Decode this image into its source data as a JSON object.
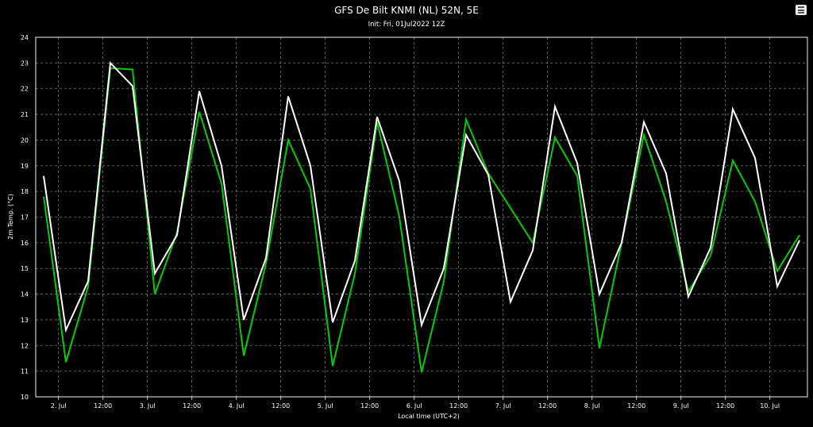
{
  "chart_data": {
    "type": "line",
    "title": "GFS De Bilt KNMI (NL) 52N, 5E",
    "subtitle": "Init: Fri, 01Jul2022 12Z",
    "xlabel": "Local time (UTC+2)",
    "ylabel": "2m Temp. (°C)",
    "ylim": [
      10,
      24
    ],
    "yticks": [
      10,
      11,
      12,
      13,
      14,
      15,
      16,
      17,
      18,
      19,
      20,
      21,
      22,
      23,
      24
    ],
    "grid": true,
    "x_start": "1 Jul 20:00",
    "x_step_hours": 6,
    "xticks": [
      {
        "hours": 4,
        "label": "2. Jul"
      },
      {
        "hours": 16,
        "label": "12:00"
      },
      {
        "hours": 28,
        "label": "3. Jul"
      },
      {
        "hours": 40,
        "label": "12:00"
      },
      {
        "hours": 52,
        "label": "4. Jul"
      },
      {
        "hours": 64,
        "label": "12:00"
      },
      {
        "hours": 76,
        "label": "5. Jul"
      },
      {
        "hours": 88,
        "label": "12:00"
      },
      {
        "hours": 100,
        "label": "6. Jul"
      },
      {
        "hours": 112,
        "label": "12:00"
      },
      {
        "hours": 124,
        "label": "7. Jul"
      },
      {
        "hours": 136,
        "label": "12:00"
      },
      {
        "hours": 148,
        "label": "8. Jul"
      },
      {
        "hours": 160,
        "label": "12:00"
      },
      {
        "hours": 172,
        "label": "9. Jul"
      },
      {
        "hours": 184,
        "label": "12:00"
      },
      {
        "hours": 196,
        "label": "10. Jul"
      }
    ],
    "series": [
      {
        "name": "series-white",
        "color": "#ffffff",
        "values": [
          18.6,
          12.6,
          14.5,
          23.0,
          22.1,
          14.8,
          16.3,
          21.9,
          19.0,
          13.0,
          15.4,
          21.7,
          19.0,
          12.9,
          15.3,
          20.9,
          18.4,
          12.8,
          15.0,
          20.2,
          18.65,
          13.7,
          15.7,
          21.3,
          19.1,
          14.0,
          16.0,
          20.7,
          18.7,
          13.9,
          15.8,
          21.2,
          19.3,
          14.3,
          16.1
        ]
      },
      {
        "name": "series-green",
        "color": "#00cc00",
        "values": [
          17.8,
          11.35,
          14.3,
          22.8,
          22.75,
          14.0,
          16.4,
          21.1,
          18.3,
          11.6,
          15.2,
          20.0,
          18.1,
          11.2,
          14.8,
          20.7,
          17.0,
          10.95,
          14.5,
          20.8,
          18.7,
          17.35,
          16.0,
          20.1,
          18.6,
          11.9,
          16.0,
          20.2,
          17.6,
          14.1,
          15.5,
          19.2,
          17.6,
          14.9,
          16.3
        ]
      }
    ]
  },
  "menu": {
    "icon": "hamburger-menu-icon"
  }
}
